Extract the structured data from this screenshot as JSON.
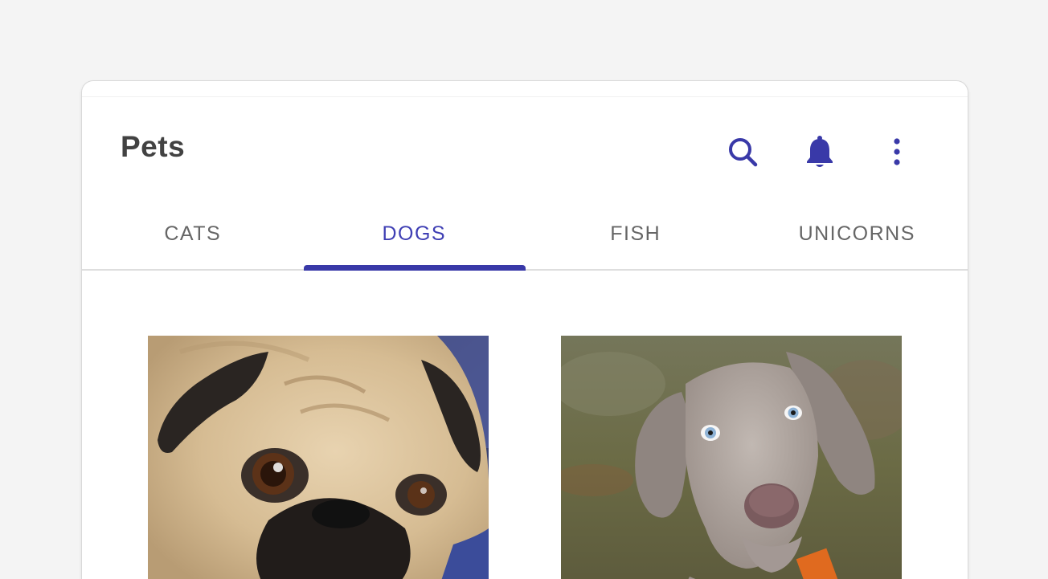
{
  "app_bar": {
    "title": "Pets"
  },
  "actions": [
    {
      "name": "search",
      "icon": "search-icon"
    },
    {
      "name": "notifications",
      "icon": "bell-icon"
    },
    {
      "name": "more",
      "icon": "more-vert-icon"
    }
  ],
  "tabs": [
    {
      "label": "CATS",
      "active": false
    },
    {
      "label": "DOGS",
      "active": true
    },
    {
      "label": "FISH",
      "active": false
    },
    {
      "label": "UNICORNS",
      "active": false
    }
  ],
  "photos": [
    {
      "subject": "pug",
      "icon": "pug-photo"
    },
    {
      "subject": "weimaraner puppy",
      "icon": "weimaraner-photo"
    }
  ],
  "colors": {
    "accent": "#3939a8",
    "tab_inactive": "#666666",
    "title": "#424242",
    "background": "#f4f4f4"
  }
}
